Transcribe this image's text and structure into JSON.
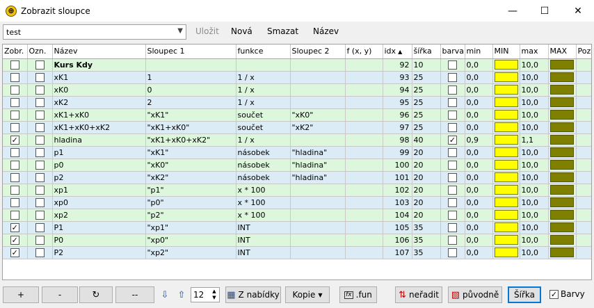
{
  "window": {
    "title": "Zobrazit sloupce",
    "minimize": "—",
    "maximize": "☐",
    "close": "✕"
  },
  "toolbar": {
    "preset_value": "test",
    "save_label": "Uložit",
    "new_label": "Nová",
    "delete_label": "Smazat",
    "name_label": "Název"
  },
  "grid": {
    "headers": [
      "Zobr.",
      "Ozn.",
      "Název",
      "Sloupec 1",
      "funkce",
      "Sloupec 2",
      "f (x, y)",
      "idx",
      "šířka",
      "barva",
      "min",
      "MIN",
      "max",
      "MAX",
      "Pozn"
    ],
    "rows": [
      {
        "zobr": false,
        "ozn": false,
        "nazev": "Kurs Kdy",
        "s1": "",
        "funkce": "",
        "s2": "",
        "fxy": "",
        "idx": "92",
        "sirka": "10",
        "barva": false,
        "min": "0,0",
        "max": "10,0",
        "bold": true
      },
      {
        "zobr": false,
        "ozn": false,
        "nazev": "xK1",
        "s1": "1",
        "funkce": "1 / x",
        "s2": "",
        "fxy": "",
        "idx": "93",
        "sirka": "25",
        "barva": false,
        "min": "0,0",
        "max": "10,0"
      },
      {
        "zobr": false,
        "ozn": false,
        "nazev": "xK0",
        "s1": "0",
        "funkce": "1 / x",
        "s2": "",
        "fxy": "",
        "idx": "94",
        "sirka": "25",
        "barva": false,
        "min": "0,0",
        "max": "10,0"
      },
      {
        "zobr": false,
        "ozn": false,
        "nazev": "xK2",
        "s1": "2",
        "funkce": "1 / x",
        "s2": "",
        "fxy": "",
        "idx": "95",
        "sirka": "25",
        "barva": false,
        "min": "0,0",
        "max": "10,0"
      },
      {
        "zobr": false,
        "ozn": false,
        "nazev": "xK1+xK0",
        "s1": "\"xK1\"",
        "funkce": "součet",
        "s2": "\"xK0\"",
        "fxy": "",
        "idx": "96",
        "sirka": "25",
        "barva": false,
        "min": "0,0",
        "max": "10,0"
      },
      {
        "zobr": false,
        "ozn": false,
        "nazev": "xK1+xK0+xK2",
        "s1": "\"xK1+xK0\"",
        "funkce": "součet",
        "s2": "\"xK2\"",
        "fxy": "",
        "idx": "97",
        "sirka": "25",
        "barva": false,
        "min": "0,0",
        "max": "10,0"
      },
      {
        "zobr": true,
        "ozn": false,
        "nazev": "hladina",
        "s1": "\"xK1+xK0+xK2\"",
        "funkce": "1 / x",
        "s2": "",
        "fxy": "",
        "idx": "98",
        "sirka": "40",
        "barva": true,
        "min": "0,9",
        "max": "1,1"
      },
      {
        "zobr": false,
        "ozn": false,
        "nazev": "p1",
        "s1": "\"xK1\"",
        "funkce": "násobek",
        "s2": "\"hladina\"",
        "fxy": "",
        "idx": "99",
        "sirka": "20",
        "barva": false,
        "min": "0,0",
        "max": "10,0"
      },
      {
        "zobr": false,
        "ozn": false,
        "nazev": "p0",
        "s1": "\"xK0\"",
        "funkce": "násobek",
        "s2": "\"hladina\"",
        "fxy": "",
        "idx": "100",
        "sirka": "20",
        "barva": false,
        "min": "0,0",
        "max": "10,0"
      },
      {
        "zobr": false,
        "ozn": false,
        "nazev": "p2",
        "s1": "\"xK2\"",
        "funkce": "násobek",
        "s2": "\"hladina\"",
        "fxy": "",
        "idx": "101",
        "sirka": "20",
        "barva": false,
        "min": "0,0",
        "max": "10,0"
      },
      {
        "zobr": false,
        "ozn": false,
        "nazev": "xp1",
        "s1": "\"p1\"",
        "funkce": "x * 100",
        "s2": "",
        "fxy": "",
        "idx": "102",
        "sirka": "20",
        "barva": false,
        "min": "0,0",
        "max": "10,0"
      },
      {
        "zobr": false,
        "ozn": false,
        "nazev": "xp0",
        "s1": "\"p0\"",
        "funkce": "x * 100",
        "s2": "",
        "fxy": "",
        "idx": "103",
        "sirka": "20",
        "barva": false,
        "min": "0,0",
        "max": "10,0"
      },
      {
        "zobr": false,
        "ozn": false,
        "nazev": "xp2",
        "s1": "\"p2\"",
        "funkce": "x * 100",
        "s2": "",
        "fxy": "",
        "idx": "104",
        "sirka": "20",
        "barva": false,
        "min": "0,0",
        "max": "10,0"
      },
      {
        "zobr": true,
        "ozn": false,
        "nazev": "P1",
        "s1": "\"xp1\"",
        "funkce": "INT",
        "s2": "",
        "fxy": "",
        "idx": "105",
        "sirka": "35",
        "barva": false,
        "min": "0,0",
        "max": "10,0"
      },
      {
        "zobr": true,
        "ozn": false,
        "nazev": "P0",
        "s1": "\"xp0\"",
        "funkce": "INT",
        "s2": "",
        "fxy": "",
        "idx": "106",
        "sirka": "35",
        "barva": false,
        "min": "0,0",
        "max": "10,0"
      },
      {
        "zobr": true,
        "ozn": false,
        "nazev": "P2",
        "s1": "\"xp2\"",
        "funkce": "INT",
        "s2": "",
        "fxy": "",
        "idx": "107",
        "sirka": "35",
        "barva": false,
        "min": "0,0",
        "max": "10,0"
      }
    ]
  },
  "bottom": {
    "add_label": "+",
    "remove_label": "-",
    "dash_label": "--",
    "spin_value": "12",
    "from_menu_label": "Z nabídky",
    "copy_label": "Kopie",
    "fun_label": ".fun",
    "unsort_label": "neřadit",
    "original_label": "původně",
    "width_label": "Šířka",
    "colors_label": "Barvy"
  },
  "colors": {
    "min_swatch": "#ffff00",
    "max_swatch": "#808000",
    "accent": "#0078d7"
  }
}
